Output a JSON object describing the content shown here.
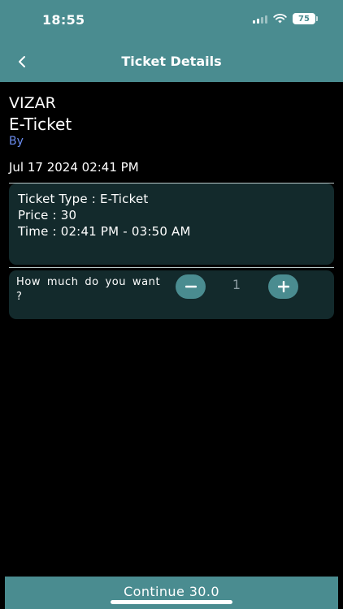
{
  "status_bar": {
    "time": "18:55",
    "battery": "75"
  },
  "header": {
    "title": "Ticket Details"
  },
  "event": {
    "name": "VIZAR",
    "ticket_kind": "E-Ticket",
    "organizer_label": "By",
    "date": "Jul 17 2024 02:41 PM"
  },
  "ticket": {
    "type_line": "Ticket Type : E-Ticket",
    "price_line": "Price : 30",
    "time_line": "Time : 02:41 PM - 03:50 AM"
  },
  "quantity": {
    "question": "How much do you want ?",
    "value": "1"
  },
  "footer": {
    "continue_label": "Continue 30.0"
  },
  "colors": {
    "accent": "#4a8c90",
    "card": "#132a2c",
    "link": "#6b8df0",
    "background": "#000000"
  }
}
